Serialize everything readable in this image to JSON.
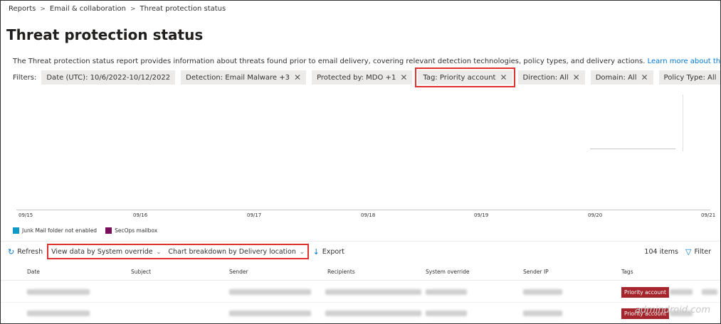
{
  "breadcrumb": [
    "Reports",
    "Email & collaboration",
    "Threat protection status"
  ],
  "page_title": "Threat protection status",
  "description": "The Threat protection status report provides information about threats found prior to email delivery, covering relevant detection technologies, policy types, and delivery actions.",
  "learn_more": "Learn more about this report",
  "filters_label": "Filters:",
  "filters": [
    {
      "label": "Date (UTC): 10/6/2022-10/12/2022",
      "removable": false,
      "highlighted": false
    },
    {
      "label": "Detection: Email Malware +3",
      "removable": true,
      "highlighted": false
    },
    {
      "label": "Protected by: MDO +1",
      "removable": true,
      "highlighted": false
    },
    {
      "label": "Tag: Priority account",
      "removable": true,
      "highlighted": true
    },
    {
      "label": "Direction: All",
      "removable": true,
      "highlighted": false
    },
    {
      "label": "Domain: All",
      "removable": true,
      "highlighted": false
    },
    {
      "label": "Policy Type: All",
      "removable": true,
      "highlighted": false
    }
  ],
  "x_ticks": [
    "09/15",
    "09/16",
    "09/17",
    "09/18",
    "09/19",
    "09/20",
    "09/21"
  ],
  "legend": [
    {
      "label": "Junk Mail folder not enabled",
      "color": "#0e9ac4"
    },
    {
      "label": "SecOps mailbox",
      "color": "#7a0e5c"
    }
  ],
  "toolbar": {
    "refresh": "Refresh",
    "view_data": "View data by System override",
    "breakdown": "Chart breakdown by Delivery location",
    "export": "Export",
    "count": "104 items",
    "filter": "Filter"
  },
  "columns": [
    "Date",
    "Subject",
    "Sender",
    "Recipients",
    "System override",
    "Sender IP",
    "Tags"
  ],
  "rows": [
    {
      "tag": "Priority account"
    },
    {
      "tag": "Priority account"
    }
  ],
  "watermark": "admindroid.com",
  "colors": {
    "accent": "#0078d4",
    "tag_bg": "#a4262c",
    "highlight": "#e03131"
  }
}
